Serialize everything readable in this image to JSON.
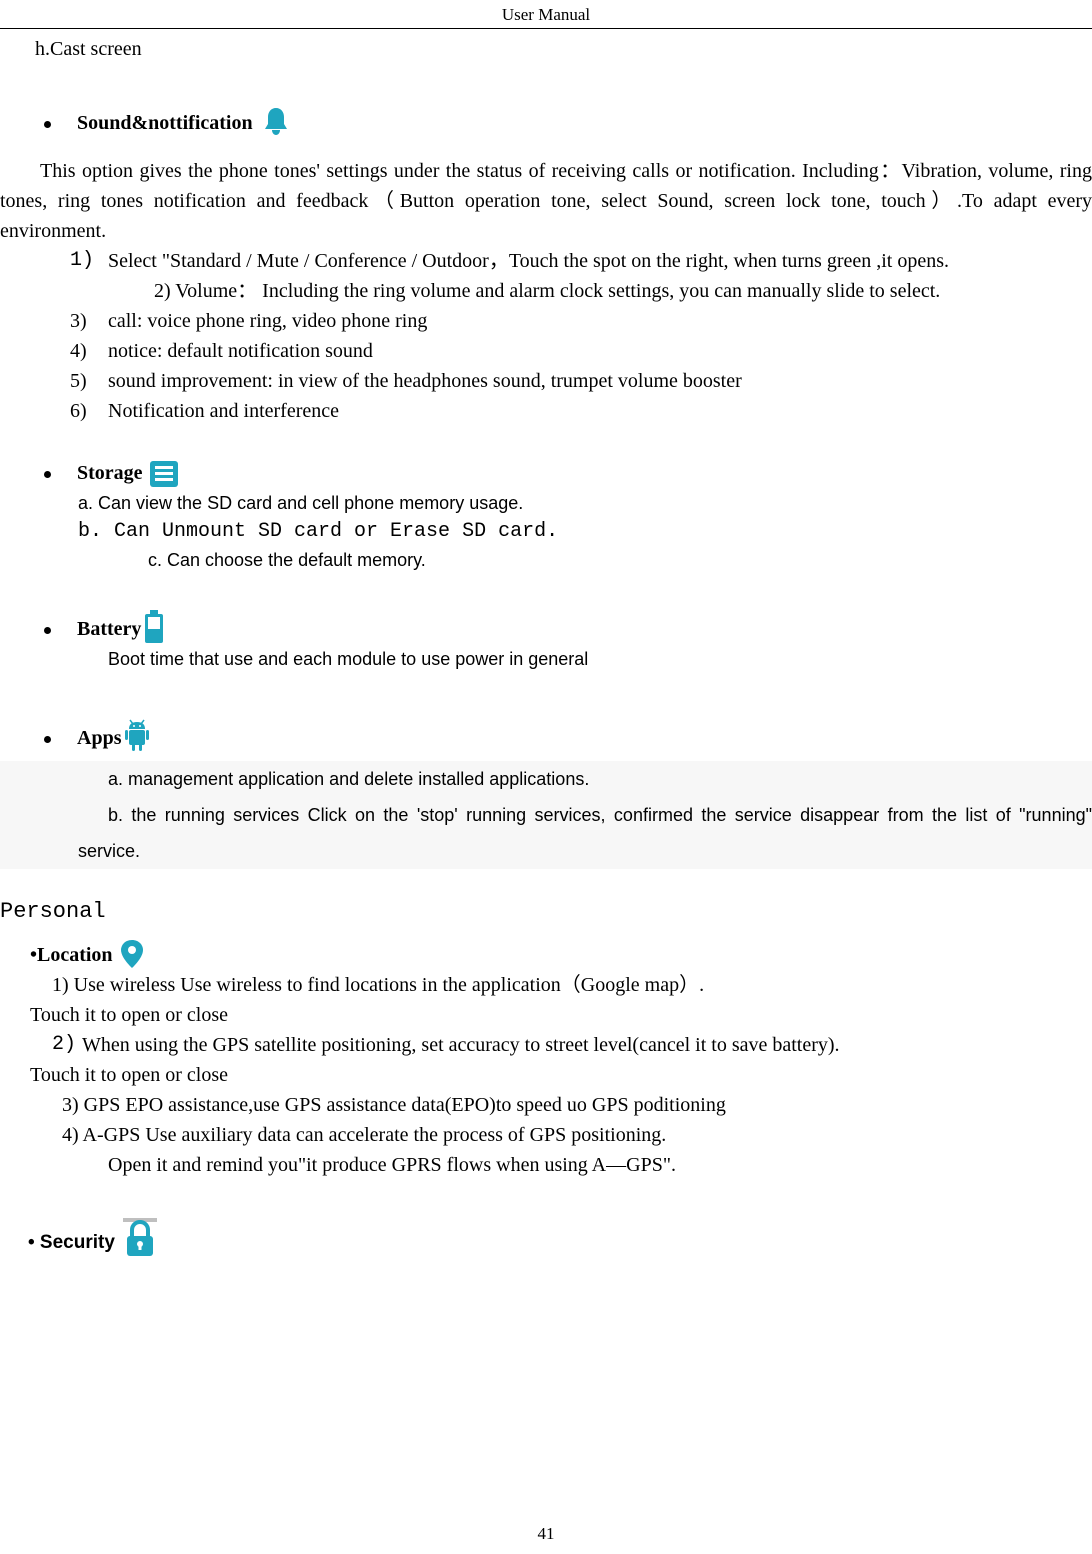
{
  "header": "User    Manual",
  "intro": "h.Cast screen",
  "sound": {
    "title": "Sound&nottification",
    "para": "This option gives the phone tones' settings under the status of receiving calls or notification. Including：Vibration, volume, ring tones, ring tones notification and feedback（Button operation tone, select Sound, screen lock tone, touch）.To adapt every environment.",
    "items": {
      "n1": "1)",
      "t1": "Select  \"Standard / Mute / Conference / Outdoor，Touch the spot on the right, when turns green ,it opens.",
      "t1b": "2) Volume：  Including the ring volume and alarm clock settings, you can manually slide to select.",
      "n3": "3)",
      "t3": "call: voice phone ring, video phone ring",
      "n4": "4)",
      "t4": "notice: default notification sound",
      "n5": "5)",
      "t5": "sound improvement: in view of the headphones sound, trumpet volume booster",
      "n6": "6)",
      "t6": "Notification and interference"
    }
  },
  "storage": {
    "title": "Storage",
    "a": "a.    Can view the SD card and cell phone memory usage.",
    "b": "b. Can Unmount SD card or Erase SD card.",
    "c": "c. Can choose the default memory."
  },
  "battery": {
    "title": "Battery",
    "line": "Boot time that use and each module to use power in general"
  },
  "apps": {
    "title": "Apps",
    "a": "a. management application and delete installed applications.",
    "b": "b. the running services Click on the 'stop' running services, confirmed the service disappear from the list of \"running\" service."
  },
  "personal": "Personal",
  "location": {
    "title": "•Location",
    "l1": "1)   Use wireless    Use wireless to find locations in the application（Google map）.",
    "touch": "Touch it to open or close",
    "l2": "When using the GPS satellite positioning, set accuracy to street level(cancel it to save battery).",
    "l2num": "2)",
    "l3": "3) GPS EPO assistance,use GPS assistance data(EPO)to speed uo GPS poditioning",
    "l4": "4) A-GPS      Use auxiliary data can accelerate the process of GPS positioning.",
    "open": "Open it and remind you\"it produce GPRS flows when using A—GPS\"."
  },
  "security": {
    "title": "• Security"
  },
  "pagenum": "41"
}
